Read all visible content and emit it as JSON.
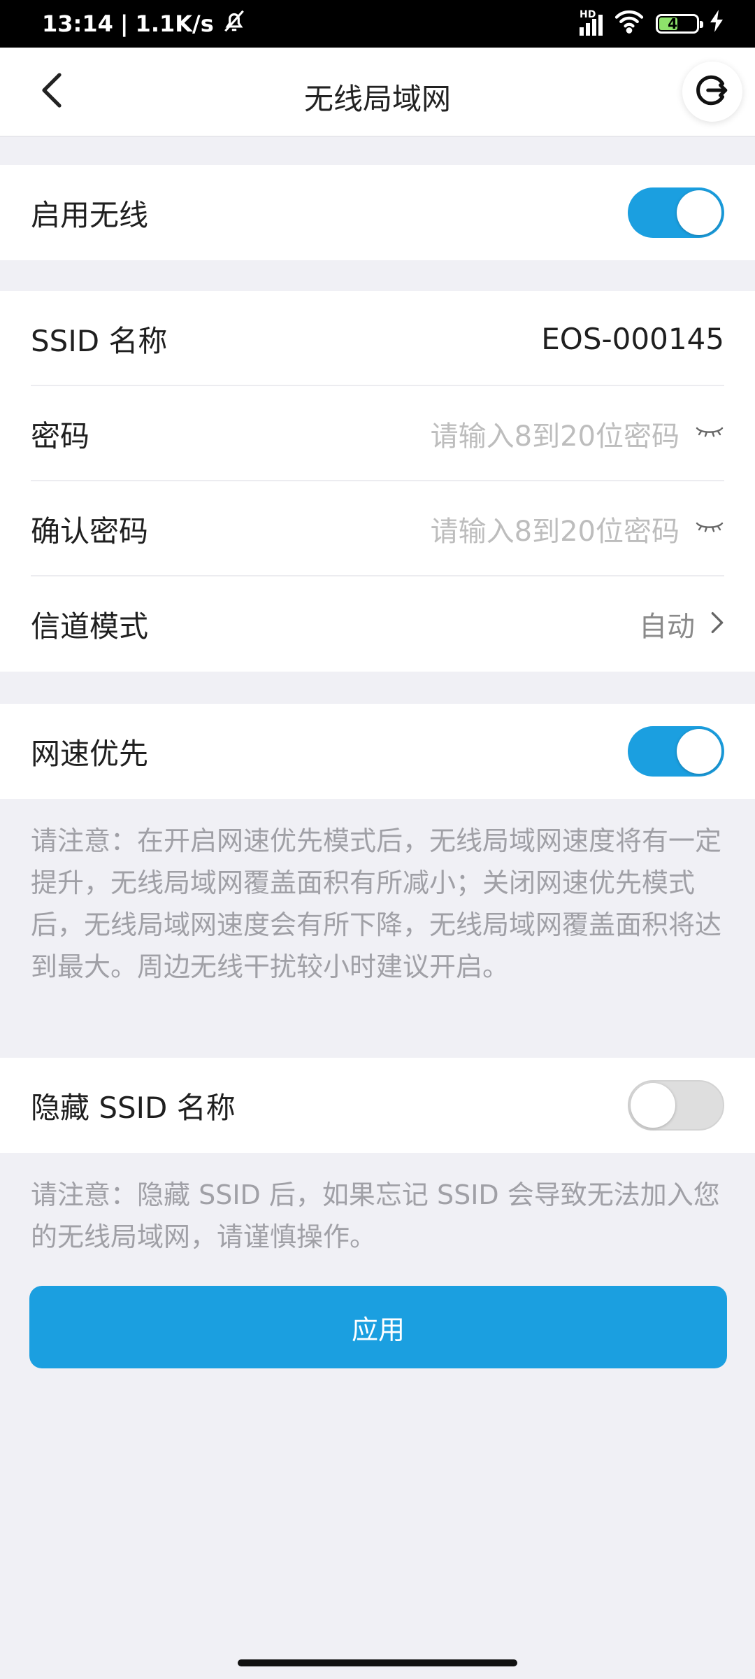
{
  "status_bar": {
    "time": "13:14",
    "separator": "|",
    "network_speed": "1.1K/s",
    "hd_label": "HD",
    "battery": "48"
  },
  "header": {
    "title": "无线局域网"
  },
  "wireless": {
    "enable_label": "启用无线",
    "enabled": true
  },
  "settings": {
    "ssid_label": "SSID 名称",
    "ssid_value": "EOS-000145",
    "password_label": "密码",
    "password_placeholder": "请输入8到20位密码",
    "confirm_label": "确认密码",
    "confirm_placeholder": "请输入8到20位密码",
    "channel_label": "信道模式",
    "channel_value": "自动"
  },
  "speed_priority": {
    "label": "网速优先",
    "enabled": true,
    "note": "请注意：在开启网速优先模式后，无线局域网速度将有一定提升，无线局域网覆盖面积有所减小；关闭网速优先模式后，无线局域网速度会有所下降，无线局域网覆盖面积将达到最大。周边无线干扰较小时建议开启。"
  },
  "hide_ssid": {
    "label": "隐藏 SSID 名称",
    "enabled": false,
    "note": "请注意：隐藏 SSID 后，如果忘记 SSID 会导致无法加入您的无线局域网，请谨慎操作。"
  },
  "apply_button": {
    "label": "应用"
  },
  "colors": {
    "accent": "#1b9fe0",
    "background": "#f0f0f5"
  },
  "icons": {
    "back": "chevron-left-icon",
    "logout": "logout-icon",
    "eye": "eye-closed-icon",
    "chevron": "chevron-right-icon"
  }
}
